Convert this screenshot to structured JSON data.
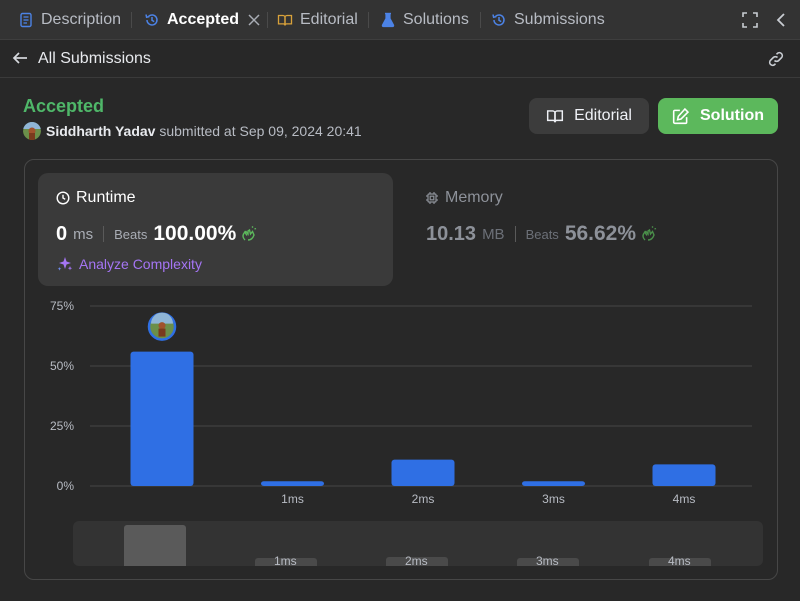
{
  "tabs": [
    {
      "label": "Description",
      "icon": "description-icon",
      "active": false
    },
    {
      "label": "Accepted",
      "icon": "history-icon",
      "active": true
    },
    {
      "label": "Editorial",
      "icon": "book-icon",
      "active": false
    },
    {
      "label": "Solutions",
      "icon": "flask-icon",
      "active": false
    },
    {
      "label": "Submissions",
      "icon": "history-icon",
      "active": false
    }
  ],
  "nav": {
    "back_label": "All Submissions"
  },
  "submission": {
    "status": "Accepted",
    "username": "Siddharth Yadav",
    "submitted_text": "submitted at Sep 09, 2024 20:41"
  },
  "buttons": {
    "editorial": "Editorial",
    "solution": "Solution"
  },
  "runtime": {
    "title": "Runtime",
    "value": "0",
    "unit": "ms",
    "beats_label": "Beats",
    "beats_pct": "100.00%",
    "analyze_label": "Analyze Complexity"
  },
  "memory": {
    "title": "Memory",
    "value": "10.13",
    "unit": "MB",
    "beats_label": "Beats",
    "beats_pct": "56.62%"
  },
  "colors": {
    "accepted": "#4fb769",
    "bar": "#2f6fe4",
    "solution_button": "#5cb85c",
    "analyze": "#a575f4"
  },
  "chart_data": {
    "type": "bar",
    "categories": [
      "0ms",
      "1ms",
      "2ms",
      "3ms",
      "4ms"
    ],
    "x_tick_labels": [
      "",
      "1ms",
      "2ms",
      "3ms",
      "4ms"
    ],
    "values": [
      56,
      2,
      11,
      2,
      9
    ],
    "y_ticks": [
      "0%",
      "25%",
      "50%",
      "75%"
    ],
    "ylim": [
      0,
      75
    ],
    "highlight_index": 0
  },
  "overview": {
    "labels": [
      "1ms",
      "2ms",
      "3ms",
      "4ms"
    ]
  }
}
